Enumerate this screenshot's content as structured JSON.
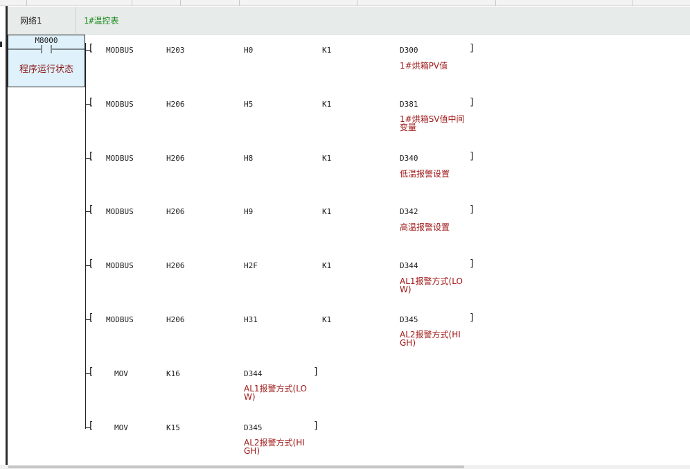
{
  "network": {
    "name": "网络1",
    "comment": "1#温控表"
  },
  "contact": {
    "address": "M8000",
    "comment": "程序运行状态"
  },
  "instructions": [
    {
      "op": "MODBUS",
      "p1": "H203",
      "p2": "H0",
      "p3": "K1",
      "dst": "D300",
      "comment": "1#烘箱PV值"
    },
    {
      "op": "MODBUS",
      "p1": "H206",
      "p2": "H5",
      "p3": "K1",
      "dst": "D381",
      "comment": "1#烘箱SV值中间\n变量"
    },
    {
      "op": "MODBUS",
      "p1": "H206",
      "p2": "H8",
      "p3": "K1",
      "dst": "D340",
      "comment": "低温报警设置"
    },
    {
      "op": "MODBUS",
      "p1": "H206",
      "p2": "H9",
      "p3": "K1",
      "dst": "D342",
      "comment": "高温报警设置"
    },
    {
      "op": "MODBUS",
      "p1": "H206",
      "p2": "H2F",
      "p3": "K1",
      "dst": "D344",
      "comment": "AL1报警方式(LO\nW)"
    },
    {
      "op": "MODBUS",
      "p1": "H206",
      "p2": "H31",
      "p3": "K1",
      "dst": "D345",
      "comment": "AL2报警方式(HI\nGH)"
    },
    {
      "op": "MOV",
      "p1": "K16",
      "dst": "D344",
      "comment": "AL1报警方式(LO\nW)"
    },
    {
      "op": "MOV",
      "p1": "K15",
      "dst": "D345",
      "comment": "AL2报警方式(HI\nGH)"
    }
  ]
}
